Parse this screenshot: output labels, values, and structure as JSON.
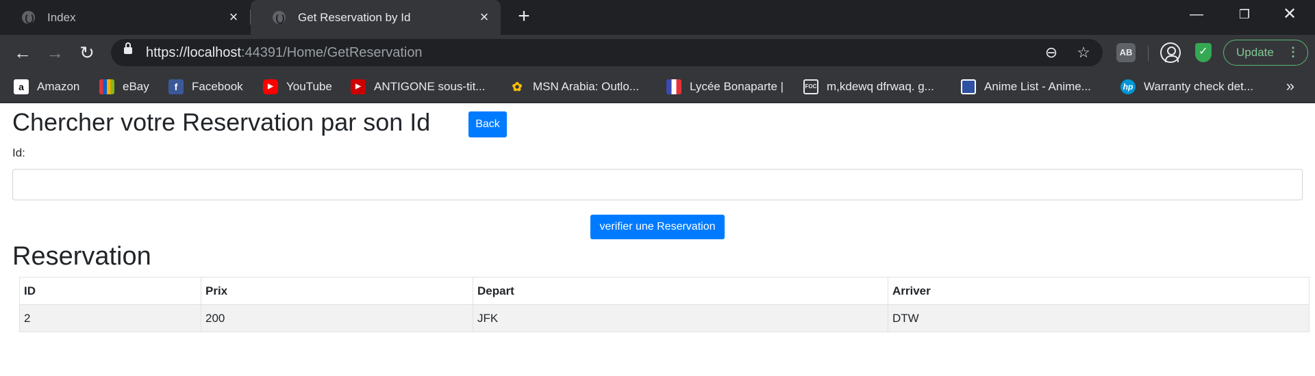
{
  "browser": {
    "tabs": [
      {
        "title": "Index",
        "active": false
      },
      {
        "title": "Get Reservation by Id",
        "active": true
      }
    ],
    "url_scheme": "https://",
    "url_host": "localhost",
    "url_rest": ":44391/Home/GetReservation",
    "update_label": "Update",
    "bookmarks": [
      {
        "label": "Amazon",
        "icon": "amazon-icon",
        "color": "#ffffff"
      },
      {
        "label": "eBay",
        "icon": "ebay-icon",
        "color": "#e53238"
      },
      {
        "label": "Facebook",
        "icon": "facebook-icon",
        "color": "#3b5998"
      },
      {
        "label": "YouTube",
        "icon": "youtube-icon",
        "color": "#ff0000"
      },
      {
        "label": "ANTIGONE sous-tit...",
        "icon": "youtube-icon",
        "color": "#cc0000"
      },
      {
        "label": "MSN Arabia: Outlo...",
        "icon": "msn-icon",
        "color": "#fbbc05"
      },
      {
        "label": "Lycée Bonaparte |",
        "icon": "lycee-icon",
        "color": "#3b4bb5"
      },
      {
        "label": "m,kdewq dfrwaq. g...",
        "icon": "film-icon",
        "color": "#e8eaed"
      },
      {
        "label": "Anime List - Anime...",
        "icon": "anime-icon",
        "color": "#2e51a2"
      },
      {
        "label": "Warranty check det...",
        "icon": "hp-icon",
        "color": "#0096d6"
      }
    ]
  },
  "page": {
    "title": "Chercher votre Reservation par son Id",
    "back_label": "Back",
    "id_label": "Id:",
    "id_value": "",
    "verify_label": "verifier une Reservation",
    "section_title": "Reservation",
    "table": {
      "headers": [
        "ID",
        "Prix",
        "Depart",
        "Arriver"
      ],
      "rows": [
        [
          "2",
          "200",
          "JFK",
          "DTW"
        ]
      ]
    }
  },
  "colors": {
    "primary": "#007bff",
    "chrome_dark": "#202124",
    "chrome_toolbar": "#35363a",
    "update_green": "#5bb974"
  }
}
